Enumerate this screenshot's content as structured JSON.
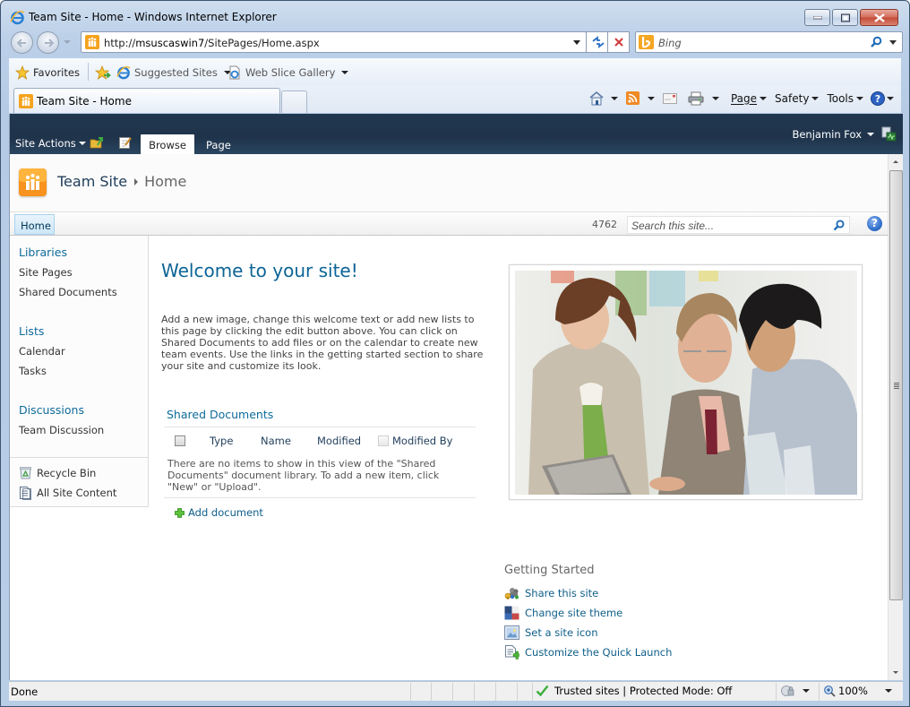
{
  "window": {
    "title": "Team Site - Home - Windows Internet Explorer"
  },
  "addressbar": {
    "url_prefix": "http://",
    "url_host": "msuscaswin7",
    "url_path": "/SitePages/Home.aspx",
    "search_provider": "Bing"
  },
  "favorites_bar": {
    "favorites_label": "Favorites",
    "items": [
      {
        "label": "Suggested Sites"
      },
      {
        "label": "Web Slice Gallery"
      }
    ]
  },
  "tabs": [
    {
      "label": "Team Site - Home",
      "active": true
    }
  ],
  "command_bar": {
    "page": "Page",
    "safety": "Safety",
    "tools": "Tools"
  },
  "ribbon": {
    "site_actions": "Site Actions",
    "tabs": [
      {
        "label": "Browse",
        "active": true
      },
      {
        "label": "Page",
        "active": false
      }
    ],
    "user_name": "Benjamin Fox"
  },
  "site": {
    "name": "Team Site",
    "current_page": "Home"
  },
  "topnav": {
    "items": [
      {
        "label": "Home",
        "selected": true
      }
    ],
    "count": "4762",
    "search_placeholder": "Search this site..."
  },
  "quick_launch": {
    "sections": [
      {
        "heading": "Libraries",
        "items": [
          "Site Pages",
          "Shared Documents"
        ]
      },
      {
        "heading": "Lists",
        "items": [
          "Calendar",
          "Tasks"
        ]
      },
      {
        "heading": "Discussions",
        "items": [
          "Team Discussion"
        ]
      }
    ],
    "utilities": [
      {
        "label": "Recycle Bin",
        "icon": "recycle-bin-icon"
      },
      {
        "label": "All Site Content",
        "icon": "all-site-content-icon"
      }
    ]
  },
  "main": {
    "welcome_title": "Welcome to your site!",
    "welcome_text": "Add a new image, change this welcome text or add new lists to this page by clicking the edit button above. You can click on Shared Documents to add files or on the calendar to create new team events. Use the links in the getting started section to share your site and customize its look.",
    "shared_documents": {
      "title": "Shared Documents",
      "columns": [
        "Type",
        "Name",
        "Modified",
        "Modified By"
      ],
      "empty_message": "There are no items to show in this view of the \"Shared Documents\" document library. To add a new item, click \"New\" or \"Upload\".",
      "add_label": "Add document"
    }
  },
  "getting_started": {
    "title": "Getting Started",
    "items": [
      {
        "label": "Share this site",
        "icon": "share-site-icon"
      },
      {
        "label": "Change site theme",
        "icon": "site-theme-icon"
      },
      {
        "label": "Set a site icon",
        "icon": "site-icon-icon"
      },
      {
        "label": "Customize the Quick Launch",
        "icon": "quick-launch-icon"
      }
    ]
  },
  "statusbar": {
    "status": "Done",
    "zone": "Trusted sites | Protected Mode: Off",
    "zoom": "100%"
  },
  "colors": {
    "ribbon_bg": "#21374f",
    "link_blue": "#0f6b9a",
    "welcome_blue": "#0c6496",
    "site_logo_orange": "#f7931e"
  }
}
